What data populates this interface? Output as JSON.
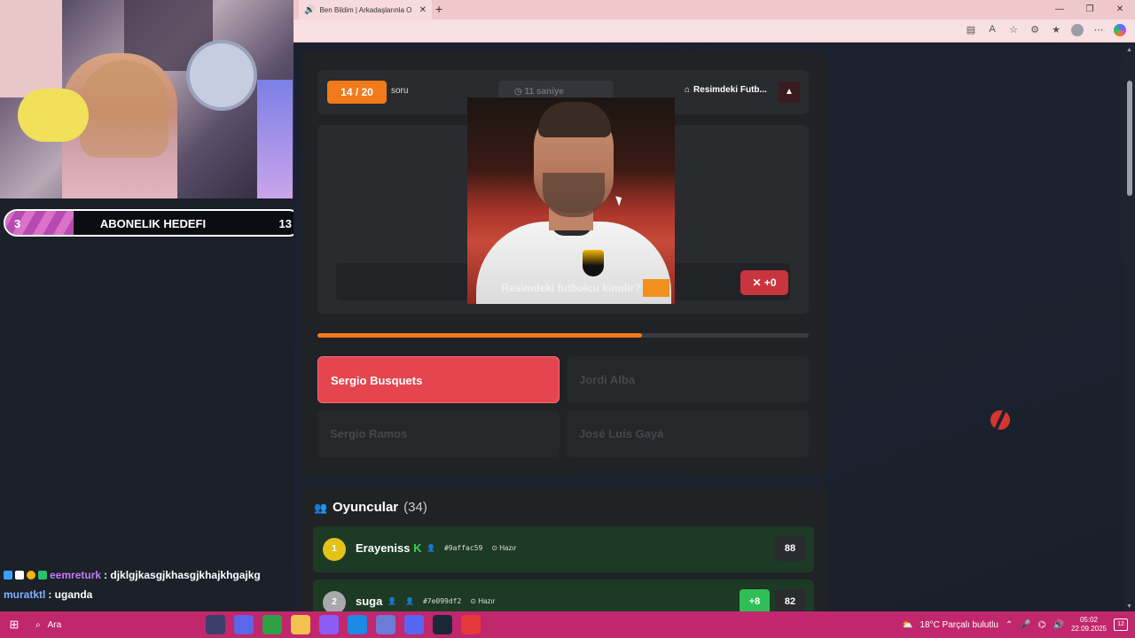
{
  "stream": {
    "sub_goal": {
      "current": "3",
      "label": "ABONELIK HEDEFI",
      "goal": "13",
      "progress": 0.23
    },
    "chat": [
      {
        "user": "eemreturk",
        "message": ": djklgjkasgjkhasgjkhajkhgajkg"
      },
      {
        "user": "muratktl",
        "message": ": uganda"
      }
    ]
  },
  "browser": {
    "tab_title": "Ben Bildim | Arkadaşlarınla O",
    "toolbar_icons": [
      "split-screen-icon",
      "read-aloud-icon",
      "favorite-star-icon",
      "extensions-icon",
      "favorites-icon",
      "profile-avatar",
      "more-icon",
      "copilot-icon"
    ]
  },
  "game": {
    "question_counter": "14 / 20",
    "question_word": "soru",
    "timer": "11 saniye",
    "category": "Resimdeki Futb...",
    "question_text": "Resimdeki futbolcu kimdir?",
    "score_delta": "+0",
    "progress": 0.66,
    "answers": [
      {
        "label": "Sergio Busquets",
        "selected": true
      },
      {
        "label": "Jordi Alba",
        "selected": false
      },
      {
        "label": "Sergio Ramos",
        "selected": false
      },
      {
        "label": "José Luis Gayá",
        "selected": false
      }
    ]
  },
  "players": {
    "title": "Oyuncular",
    "count": "(34)",
    "list": [
      {
        "rank": "1",
        "name": "Erayeniss",
        "hash": "#9affac59",
        "status": "Hazır",
        "points": "88",
        "delta": "",
        "rank_color": "#e3c21a"
      },
      {
        "rank": "2",
        "name": "suga",
        "hash": "#7e099df2",
        "status": "Hazır",
        "points": "82",
        "delta": "+8",
        "rank_color": "#a7a9ad"
      }
    ]
  },
  "taskbar": {
    "search_placeholder": "Ara",
    "weather": "18°C  Parçalı bulutlu",
    "time": "05:02",
    "date": "22.09.2025",
    "notifications": "12"
  }
}
